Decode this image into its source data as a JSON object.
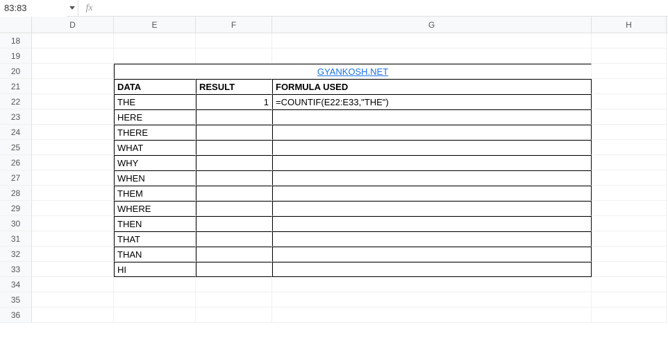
{
  "formula_bar": {
    "name_box": "83:83",
    "formula": ""
  },
  "columns": [
    "D",
    "E",
    "F",
    "G",
    "H"
  ],
  "row_numbers": [
    "18",
    "19",
    "20",
    "21",
    "22",
    "23",
    "24",
    "25",
    "26",
    "27",
    "28",
    "29",
    "30",
    "31",
    "32",
    "33",
    "34",
    "35",
    "36"
  ],
  "cells": {
    "r20": {
      "link": "GYANKOSH.NET"
    },
    "r21": {
      "E": "DATA",
      "F": "RESULT",
      "G": "FORMULA USED"
    },
    "r22": {
      "E": "THE",
      "F": "1",
      "G": "=COUNTIF(E22:E33,\"THE\")"
    },
    "r23": {
      "E": "HERE"
    },
    "r24": {
      "E": "THERE"
    },
    "r25": {
      "E": "WHAT"
    },
    "r26": {
      "E": "WHY"
    },
    "r27": {
      "E": "WHEN"
    },
    "r28": {
      "E": "THEM"
    },
    "r29": {
      "E": "WHERE"
    },
    "r30": {
      "E": "THEN"
    },
    "r31": {
      "E": "THAT"
    },
    "r32": {
      "E": "THAN"
    },
    "r33": {
      "E": "HI"
    }
  }
}
